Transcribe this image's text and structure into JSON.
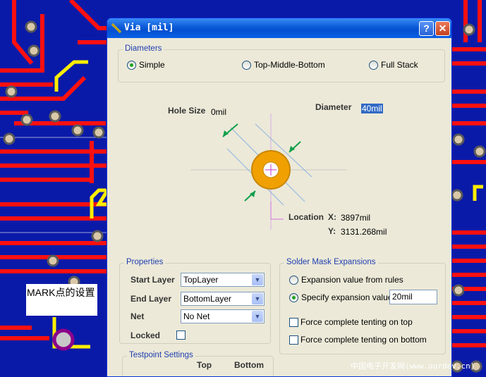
{
  "window": {
    "title": "Via [mil]"
  },
  "diameters": {
    "group_title": "Diameters",
    "options": [
      {
        "label": "Simple",
        "selected": true
      },
      {
        "label": "Top-Middle-Bottom",
        "selected": false
      },
      {
        "label": "Full Stack",
        "selected": false
      }
    ]
  },
  "preview": {
    "hole_size_label": "Hole Size",
    "hole_size_value": "0mil",
    "diameter_label": "Diameter",
    "diameter_value": "40mil",
    "location_label": "Location",
    "x_label": "X:",
    "x_value": "3897mil",
    "y_label": "Y:",
    "y_value": "3131.268mil"
  },
  "properties": {
    "group_title": "Properties",
    "start_layer_label": "Start Layer",
    "start_layer_value": "TopLayer",
    "end_layer_label": "End Layer",
    "end_layer_value": "BottomLayer",
    "net_label": "Net",
    "net_value": "No Net",
    "locked_label": "Locked",
    "locked": false
  },
  "solder_mask": {
    "group_title": "Solder Mask Expansions",
    "rule_option": "Expansion value from rules",
    "specify_option": "Specify expansion value",
    "specify_value": "20mil",
    "selected": "specify",
    "tent_top_label": "Force complete tenting on top",
    "tent_bottom_label": "Force complete tenting on bottom"
  },
  "testpoint": {
    "group_title": "Testpoint Settings",
    "col_top": "Top",
    "col_bottom": "Bottom"
  },
  "background": {
    "annotation_text": "MARK点的设置",
    "watermark": "中国电子开发网(www.ourdev.cn)"
  },
  "colors": {
    "board": "#0a1aa8",
    "trace_red": "#ff1010",
    "via_ring": "#f0a000",
    "dialog_bg": "#ece9d8",
    "titlebar": "#0a5ad8"
  }
}
